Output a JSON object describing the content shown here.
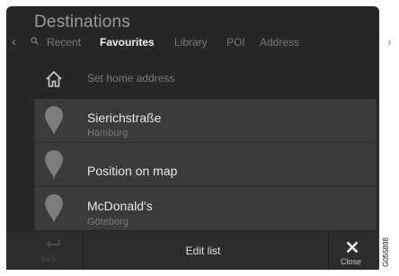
{
  "header": {
    "title": "Destinations"
  },
  "tabs": [
    {
      "label": "Recent",
      "active": false
    },
    {
      "label": "Favourites",
      "active": true
    },
    {
      "label": "Library",
      "active": false
    },
    {
      "label": "POI",
      "active": false
    },
    {
      "label": "Address",
      "active": false
    }
  ],
  "home": {
    "label": "Set home address",
    "icon": "home-icon"
  },
  "destinations": [
    {
      "name": "Sierichstraße",
      "location": "Hamburg",
      "icon": "map-pin-icon"
    },
    {
      "name": "Position on map",
      "location": "",
      "icon": "map-pin-icon"
    },
    {
      "name": "McDonald's",
      "location": "Göteborg",
      "icon": "map-pin-icon"
    }
  ],
  "toolbar": {
    "back_label": "Back",
    "edit_label": "Edit list",
    "close_label": "Close"
  },
  "figure_code": "G055898",
  "colors": {
    "background": "#262626",
    "list_background": "#3a3a3a",
    "active_tab": "#f2f2f2",
    "muted_text": "#7a7a7a"
  }
}
